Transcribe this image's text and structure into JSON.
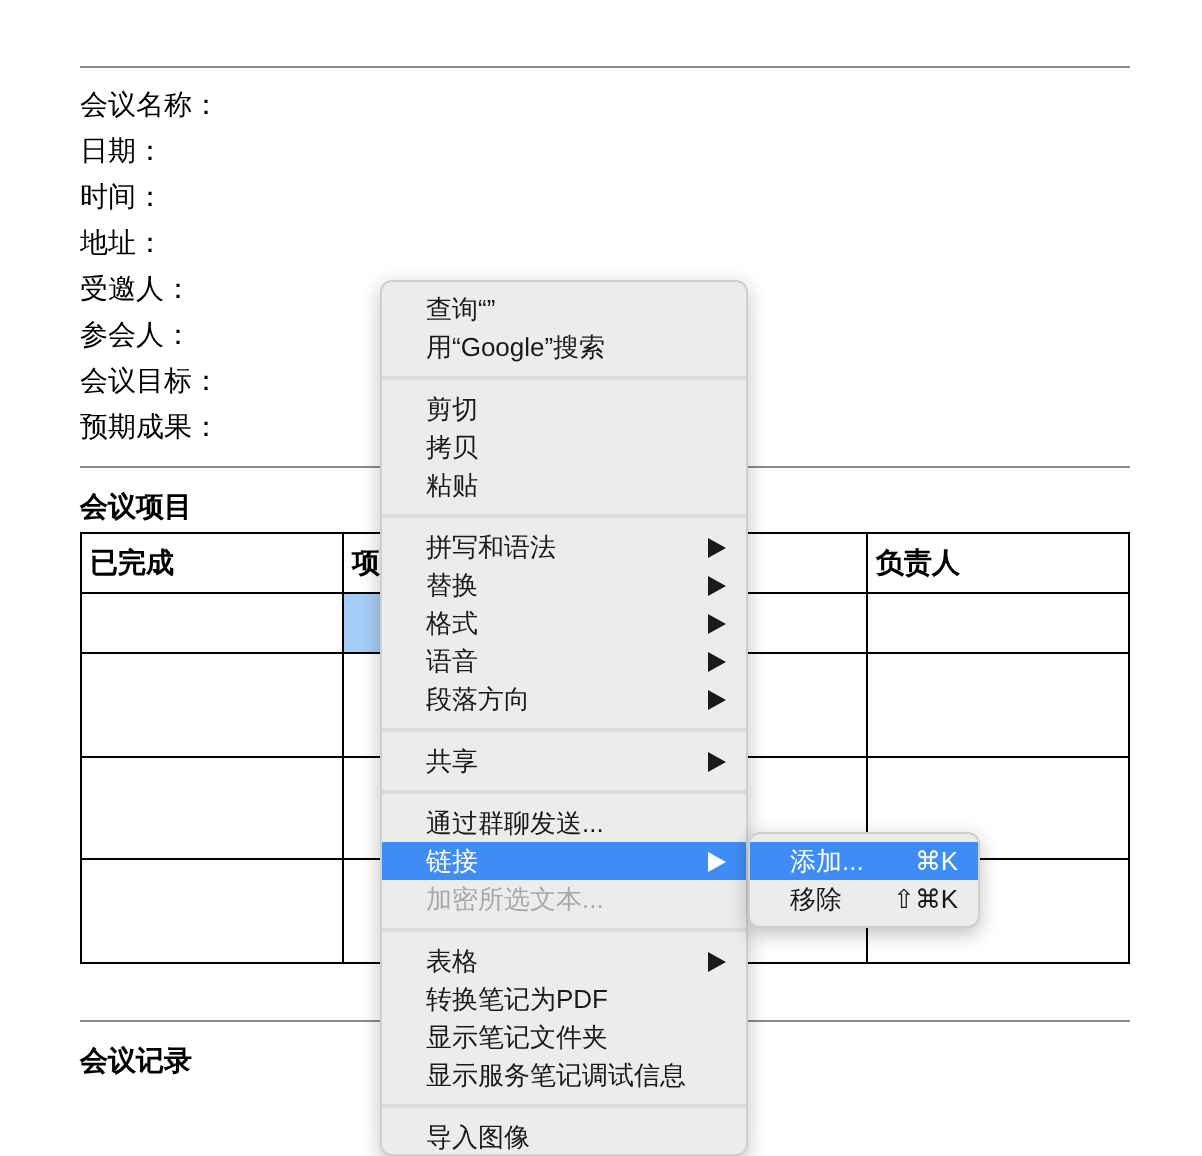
{
  "document": {
    "fields": [
      "会议名称：",
      "日期：",
      "时间：",
      "地址：",
      "受邀人：",
      "参会人：",
      "会议目标：",
      "预期成果："
    ],
    "agenda_title": "会议项目",
    "table": {
      "columns": [
        "已完成",
        "项",
        "",
        "负责人"
      ],
      "rows": [
        {
          "cells": [
            {
              "selected": false
            },
            {
              "selected": true
            },
            {
              "selected": false
            },
            {
              "selected": false
            }
          ]
        },
        {
          "cells": [
            {
              "selected": false
            },
            {
              "selected": false
            },
            {
              "selected": false
            },
            {
              "selected": false
            }
          ]
        },
        {
          "cells": [
            {
              "selected": false
            },
            {
              "selected": false
            },
            {
              "selected": false
            },
            {
              "selected": false
            }
          ]
        },
        {
          "cells": [
            {
              "selected": false
            },
            {
              "selected": false
            },
            {
              "selected": false
            },
            {
              "selected": false
            }
          ]
        }
      ]
    },
    "notes_title": "会议记录"
  },
  "context_menu": {
    "sections": [
      {
        "items": [
          {
            "label": "查询“”",
            "submenu": false,
            "disabled": false,
            "selected": false
          },
          {
            "label": "用“Google”搜索",
            "submenu": false,
            "disabled": false,
            "selected": false
          }
        ]
      },
      {
        "items": [
          {
            "label": "剪切",
            "submenu": false,
            "disabled": false,
            "selected": false
          },
          {
            "label": "拷贝",
            "submenu": false,
            "disabled": false,
            "selected": false
          },
          {
            "label": "粘贴",
            "submenu": false,
            "disabled": false,
            "selected": false
          }
        ]
      },
      {
        "items": [
          {
            "label": "拼写和语法",
            "submenu": true,
            "disabled": false,
            "selected": false
          },
          {
            "label": "替换",
            "submenu": true,
            "disabled": false,
            "selected": false
          },
          {
            "label": "格式",
            "submenu": true,
            "disabled": false,
            "selected": false
          },
          {
            "label": "语音",
            "submenu": true,
            "disabled": false,
            "selected": false
          },
          {
            "label": "段落方向",
            "submenu": true,
            "disabled": false,
            "selected": false
          }
        ]
      },
      {
        "items": [
          {
            "label": "共享",
            "submenu": true,
            "disabled": false,
            "selected": false
          }
        ]
      },
      {
        "items": [
          {
            "label": "通过群聊发送...",
            "submenu": false,
            "disabled": false,
            "selected": false
          },
          {
            "label": "链接",
            "submenu": true,
            "disabled": false,
            "selected": true
          },
          {
            "label": "加密所选文本...",
            "submenu": false,
            "disabled": true,
            "selected": false
          }
        ]
      },
      {
        "items": [
          {
            "label": "表格",
            "submenu": true,
            "disabled": false,
            "selected": false
          },
          {
            "label": "转换笔记为PDF",
            "submenu": false,
            "disabled": false,
            "selected": false
          },
          {
            "label": "显示笔记文件夹",
            "submenu": false,
            "disabled": false,
            "selected": false
          },
          {
            "label": "显示服务笔记调试信息",
            "submenu": false,
            "disabled": false,
            "selected": false
          }
        ]
      },
      {
        "items": [
          {
            "label": "导入图像",
            "submenu": false,
            "disabled": false,
            "selected": false
          }
        ]
      }
    ]
  },
  "submenu": {
    "items": [
      {
        "label": "添加...",
        "shortcut": "⌘K",
        "selected": true
      },
      {
        "label": "移除",
        "shortcut": "⇧⌘K",
        "selected": false
      }
    ]
  }
}
